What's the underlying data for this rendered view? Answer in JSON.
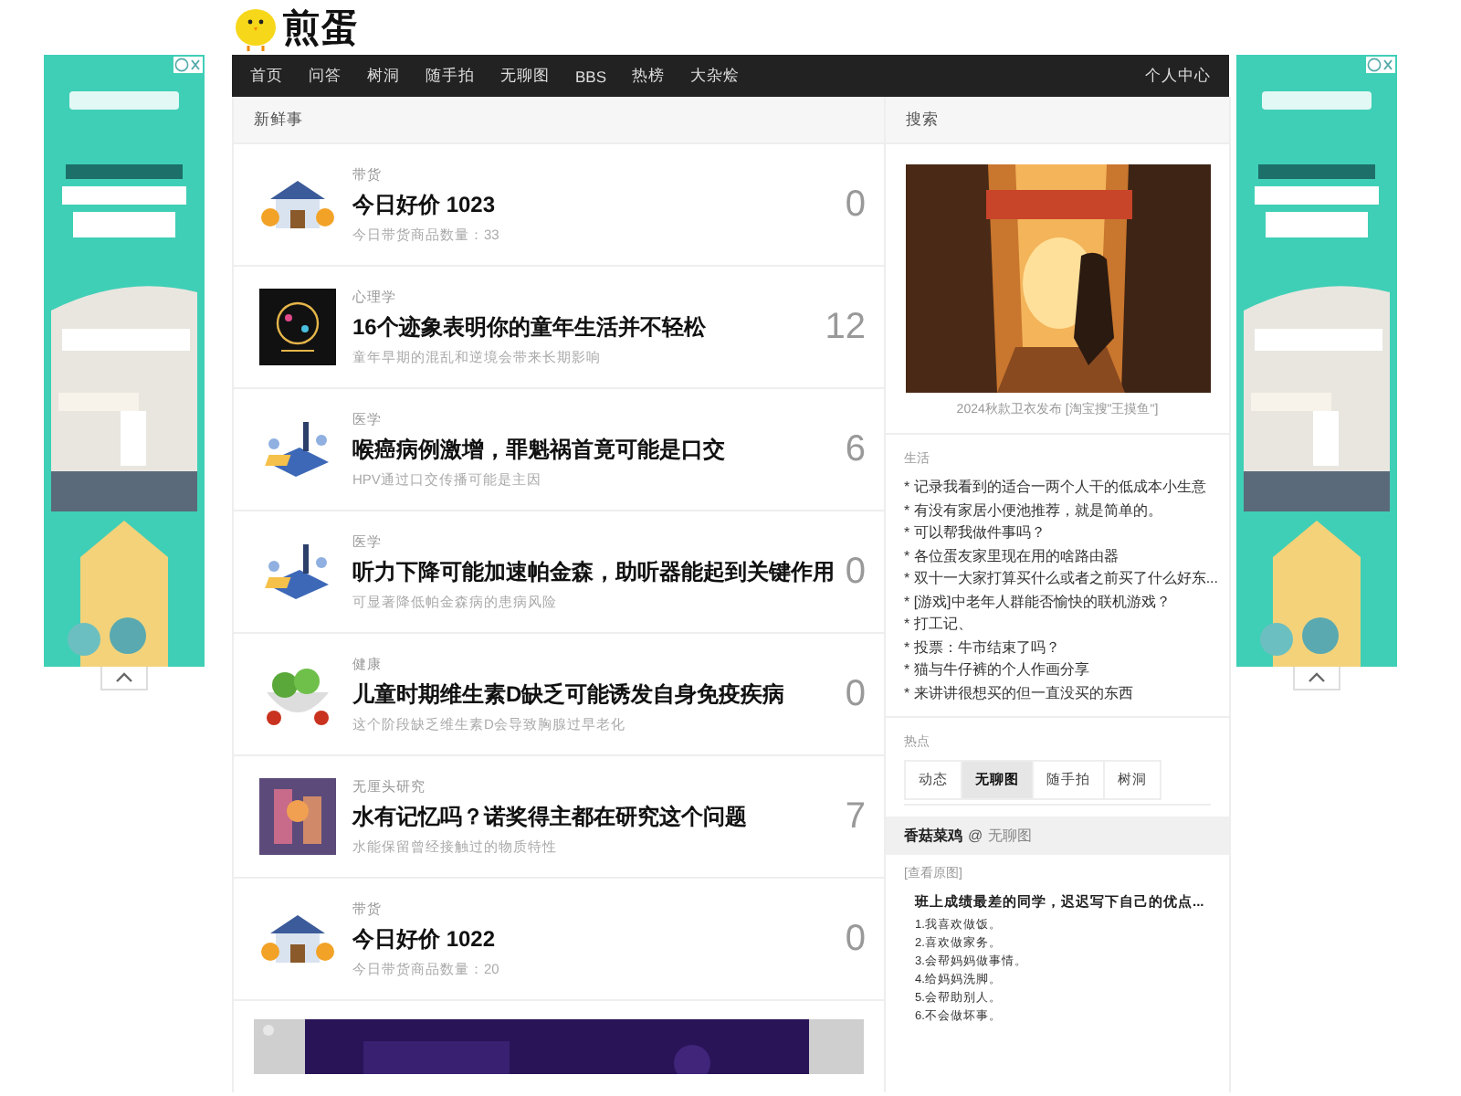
{
  "logo": {
    "text": "煎蛋"
  },
  "nav": {
    "items": [
      {
        "label": "首页"
      },
      {
        "label": "问答"
      },
      {
        "label": "树洞"
      },
      {
        "label": "随手拍"
      },
      {
        "label": "无聊图"
      },
      {
        "label": "BBS"
      },
      {
        "label": "热榜"
      },
      {
        "label": "大杂烩"
      }
    ],
    "account": "个人中心"
  },
  "feed": {
    "title": "新鲜事",
    "posts": [
      {
        "category": "带货",
        "title": "今日好价 1023",
        "summary": "今日带货商品数量：33",
        "count": "0",
        "kind": "house"
      },
      {
        "category": "心理学",
        "title": "16个迹象表明你的童年生活并不轻松",
        "summary": "童年早期的混乱和逆境会带来长期影响",
        "count": "12",
        "kind": "head"
      },
      {
        "category": "医学",
        "title": "喉癌病例激增，罪魁祸首竟可能是口交",
        "summary": "HPV通过口交传播可能是主因",
        "count": "6",
        "kind": "medical"
      },
      {
        "category": "医学",
        "title": "听力下降可能加速帕金森，助听器能起到关键作用",
        "summary": "可显著降低帕金森病的患病风险",
        "count": "0",
        "kind": "medical"
      },
      {
        "category": "健康",
        "title": "儿童时期维生素D缺乏可能诱发自身免疫疾病",
        "summary": "这个阶段缺乏维生素D会导致胸腺过早老化",
        "count": "0",
        "kind": "food"
      },
      {
        "category": "无厘头研究",
        "title": "水有记忆吗？诺奖得主都在研究这个问题",
        "summary": "水能保留曾经接触过的物质特性",
        "count": "7",
        "kind": "art"
      },
      {
        "category": "带货",
        "title": "今日好价 1022",
        "summary": "今日带货商品数量：20",
        "count": "0",
        "kind": "house"
      }
    ]
  },
  "sidebar": {
    "search_title": "搜索",
    "photo_caption": "2024秋款卫衣发布 [淘宝搜\"王摸鱼\"]",
    "forum_title": "生活",
    "forum_links": [
      "* 记录我看到的适合一两个人干的低成本小生意",
      "* 有没有家居小便池推荐，就是简单的。",
      "* 可以帮我做件事吗？",
      "* 各位蛋友家里现在用的啥路由器",
      "* 双十一大家打算买什么或者之前买了什么好东...",
      "* [游戏]中老年人群能否愉快的联机游戏？",
      "* 打工记、",
      "* 投票：牛市结束了吗？",
      "* 猫与牛仔裤的个人作画分享",
      "* 来讲讲很想买的但一直没买的东西"
    ],
    "hot_title": "热点",
    "hot_tabs": [
      {
        "label": "动态",
        "selected": false
      },
      {
        "label": "无聊图",
        "selected": true
      },
      {
        "label": "随手拍",
        "selected": false
      },
      {
        "label": "树洞",
        "selected": false
      }
    ],
    "hot_post": {
      "author": "香菇菜鸡",
      "at": "@",
      "board": "无聊图",
      "view_original": "[查看原图]",
      "doc_title": "班上成绩最差的同学，迟迟写下自己的优点...",
      "doc_lines": [
        "1.我喜欢做饭。",
        "2.喜欢做家务。",
        "3.会帮妈妈做事情。",
        "4.给妈妈洗脚。",
        "5.会帮助别人。",
        "6.不会做坏事。"
      ]
    }
  }
}
